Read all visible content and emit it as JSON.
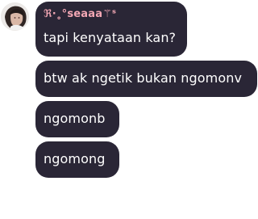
{
  "messages": [
    {
      "sender": "ℜ·˳°seaaa⚚ˢ",
      "text": "tapi kenyataan kan?"
    },
    {
      "text": "btw ak ngetik bukan ngomonv"
    },
    {
      "text": "ngomonb"
    },
    {
      "text": "ngomong"
    }
  ],
  "colors": {
    "bubble": "#2a2636",
    "text": "#ffffff",
    "sender": "#f3a7b4"
  }
}
